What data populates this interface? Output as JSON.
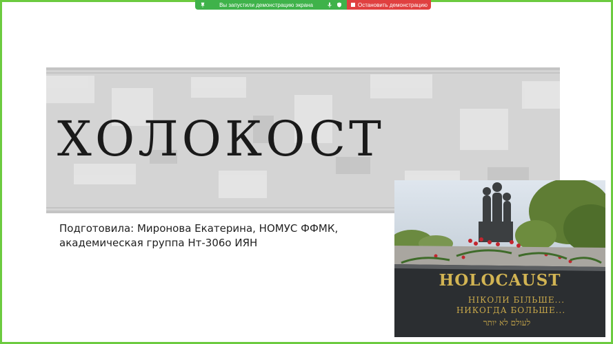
{
  "screen_share": {
    "status_text": "Вы запустили демонстрацию экрана",
    "stop_label": "Остановить демонстрацию",
    "frame_color": "#6ccb3f",
    "status_color": "#3fb24a",
    "stop_color": "#e04040"
  },
  "slide": {
    "title": "ХОЛОКОСТ",
    "subtitle_line1": "Подготовила: Миронова Екатерина, НОМУС ФФМК,",
    "subtitle_line2": "академическая группа Нт-306о ИЯН",
    "band_color": "#d4d4d4"
  },
  "photo": {
    "engraving_title": "HOLOCAUST",
    "engraving_line1": "НІКОЛИ БІЛЬШЕ...",
    "engraving_line2": "НИКОГДА БОЛЬШЕ...",
    "engraving_line3": "לעולם לא יותר"
  }
}
